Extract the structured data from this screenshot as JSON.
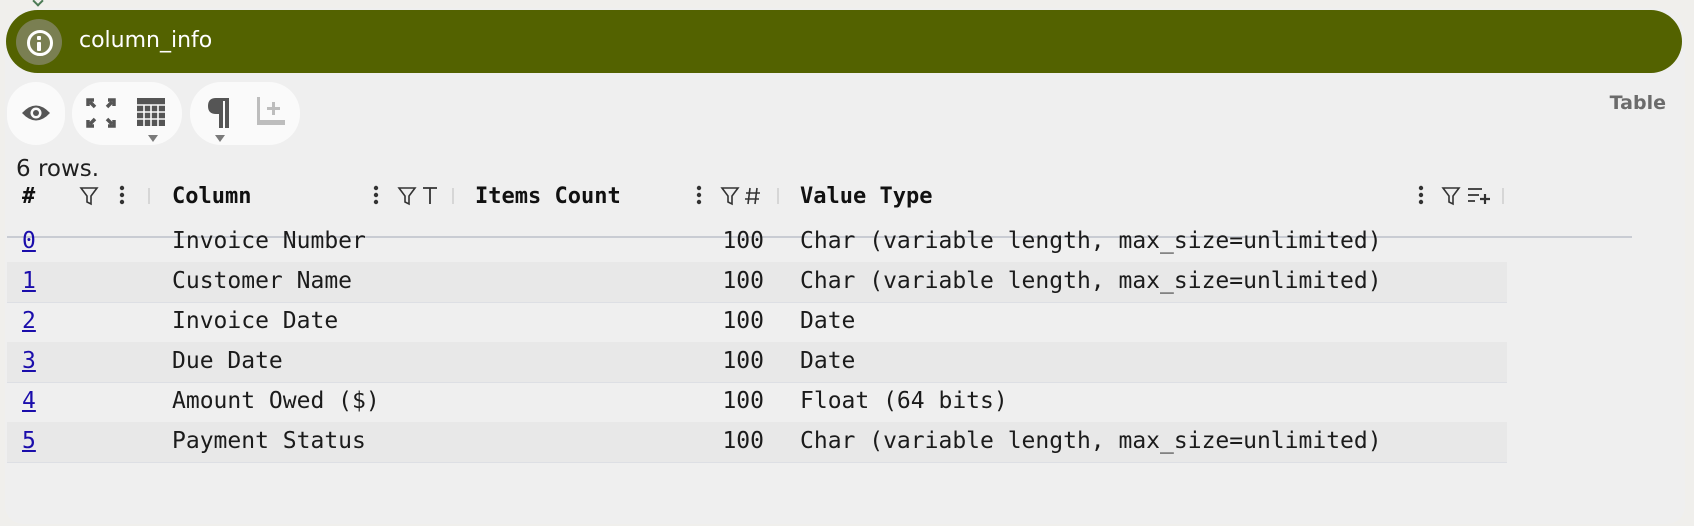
{
  "panel": {
    "title": "column_info",
    "mode_label": "Table",
    "row_count_text": "6 rows."
  },
  "toolbar": {
    "icons": [
      "eye-icon",
      "fullscreen-icon",
      "table-icon",
      "pilcrow-icon",
      "add-row-icon"
    ]
  },
  "table": {
    "headers": {
      "index": "#",
      "column": "Column",
      "items_count": "Items Count",
      "value_type": "Value Type"
    },
    "rows": [
      {
        "index": "0",
        "column": "Invoice Number",
        "items_count": "100",
        "value_type": "Char (variable length, max_size=unlimited)"
      },
      {
        "index": "1",
        "column": "Customer Name",
        "items_count": "100",
        "value_type": "Char (variable length, max_size=unlimited)"
      },
      {
        "index": "2",
        "column": "Invoice Date",
        "items_count": "100",
        "value_type": "Date"
      },
      {
        "index": "3",
        "column": "Due Date",
        "items_count": "100",
        "value_type": "Date"
      },
      {
        "index": "4",
        "column": "Amount Owed ($)",
        "items_count": "100",
        "value_type": "Float (64 bits)"
      },
      {
        "index": "5",
        "column": "Payment Status",
        "items_count": "100",
        "value_type": "Char (variable length, max_size=unlimited)"
      }
    ]
  },
  "colors": {
    "titlebar": "#536200",
    "link": "#1a0dab"
  }
}
